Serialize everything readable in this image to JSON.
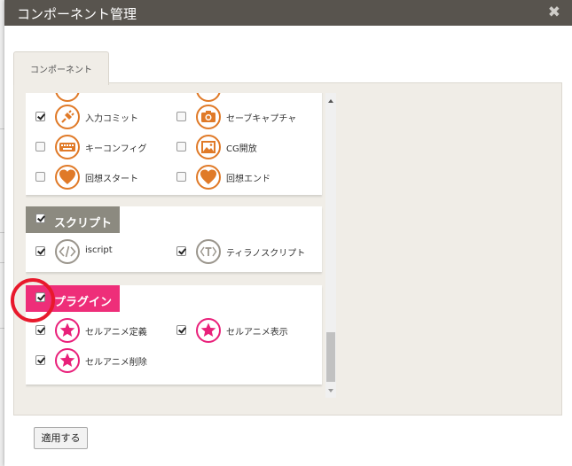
{
  "dialog": {
    "title": "コンポーネント管理",
    "close_glyph": "✖"
  },
  "tabs": [
    {
      "label": "コンポーネント"
    }
  ],
  "groups": {
    "top_items": [
      {
        "label": "入力コミット",
        "checked": true,
        "icon": "unplug-icon",
        "color": "#e07a28"
      },
      {
        "label": "セーブキャプチャ",
        "checked": false,
        "icon": "camera-icon",
        "color": "#e07a28"
      },
      {
        "label": "キーコンフィグ",
        "checked": false,
        "icon": "keyboard-icon",
        "color": "#e07a28"
      },
      {
        "label": "CG開放",
        "checked": false,
        "icon": "image-icon",
        "color": "#e07a28"
      },
      {
        "label": "回想スタート",
        "checked": false,
        "icon": "heart-icon",
        "color": "#e07a28"
      },
      {
        "label": "回想エンド",
        "checked": false,
        "icon": "heart-icon",
        "color": "#e07a28"
      }
    ],
    "script": {
      "header": "スクリプト",
      "checked": true,
      "color": "#8c8a80",
      "items": [
        {
          "label": "iscript",
          "checked": true,
          "icon": "code-icon"
        },
        {
          "label": "ティラノスクリプト",
          "checked": true,
          "icon": "tag-t-icon"
        }
      ]
    },
    "plugin": {
      "header": "プラグイン",
      "checked": true,
      "color": "#ee2e79",
      "items": [
        {
          "label": "セルアニメ定義",
          "checked": true,
          "icon": "star-icon"
        },
        {
          "label": "セルアニメ表示",
          "checked": true,
          "icon": "star-icon"
        },
        {
          "label": "セルアニメ削除",
          "checked": true,
          "icon": "star-icon"
        }
      ]
    }
  },
  "buttons": {
    "apply": "適用する"
  },
  "annotation": {
    "highlight_color": "#e8192c"
  }
}
